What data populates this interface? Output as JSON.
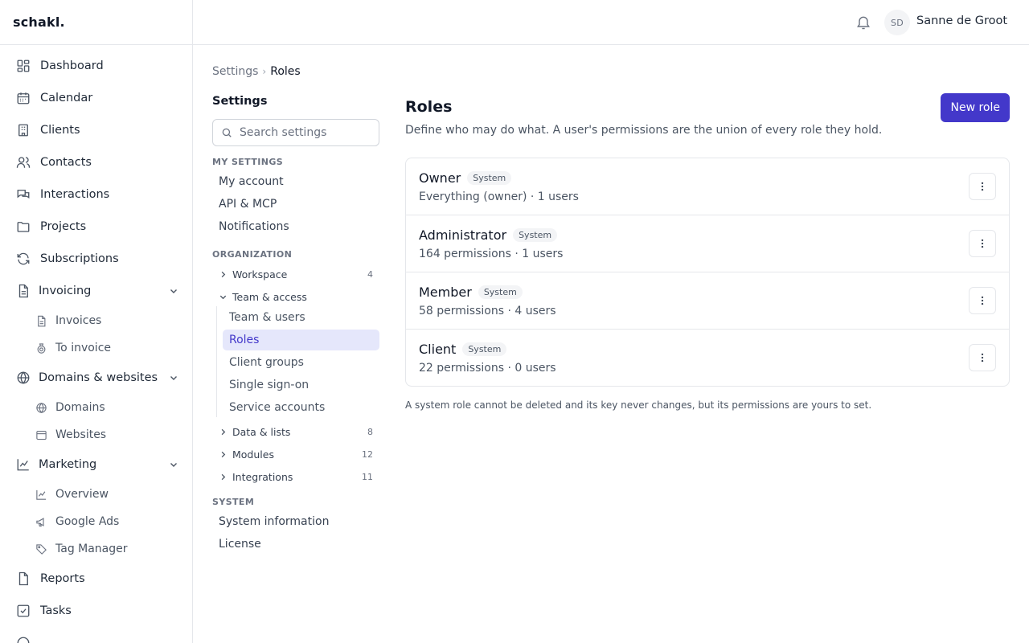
{
  "app": {
    "logo": "schakl."
  },
  "sidebar": {
    "items": [
      {
        "label": "Dashboard",
        "icon": "dashboard-icon"
      },
      {
        "label": "Calendar",
        "icon": "calendar-icon"
      },
      {
        "label": "Clients",
        "icon": "clients-icon"
      },
      {
        "label": "Contacts",
        "icon": "contacts-icon"
      },
      {
        "label": "Interactions",
        "icon": "interactions-icon"
      },
      {
        "label": "Projects",
        "icon": "folder-icon"
      },
      {
        "label": "Subscriptions",
        "icon": "refresh-icon"
      }
    ],
    "invoicing": {
      "label": "Invoicing",
      "children": [
        "Invoices",
        "To invoice"
      ]
    },
    "domains": {
      "label": "Domains & websites",
      "children": [
        "Domains",
        "Websites"
      ]
    },
    "marketing": {
      "label": "Marketing",
      "children": [
        "Overview",
        "Google Ads",
        "Tag Manager"
      ]
    },
    "bottom_items": [
      {
        "label": "Reports",
        "icon": "reports-icon"
      },
      {
        "label": "Tasks",
        "icon": "tasks-icon"
      }
    ]
  },
  "topbar": {
    "avatar_initials": "SD",
    "user_name": "Sanne de Groot"
  },
  "breadcrumb": {
    "parent": "Settings",
    "separator": "›",
    "current": "Roles"
  },
  "settings_nav": {
    "title": "Settings",
    "search_placeholder": "Search settings",
    "my_settings": {
      "label": "MY SETTINGS",
      "items": [
        "My account",
        "API & MCP",
        "Notifications"
      ]
    },
    "organization": {
      "label": "ORGANIZATION",
      "workspace": {
        "label": "Workspace",
        "count": "4"
      },
      "team_access": {
        "label": "Team & access",
        "children": [
          "Team & users",
          "Roles",
          "Client groups",
          "Single sign-on",
          "Service accounts"
        ]
      },
      "data_lists": {
        "label": "Data & lists",
        "count": "8"
      },
      "modules": {
        "label": "Modules",
        "count": "12"
      },
      "integrations": {
        "label": "Integrations",
        "count": "11"
      }
    },
    "system": {
      "label": "SYSTEM",
      "items": [
        "System information",
        "License"
      ]
    }
  },
  "main": {
    "title": "Roles",
    "description": "Define who may do what. A user's permissions are the union of every role they hold.",
    "new_role_button": "New role",
    "roles": [
      {
        "name": "Owner",
        "badge": "System",
        "meta": "Everything (owner) · 1 users"
      },
      {
        "name": "Administrator",
        "badge": "System",
        "meta": "164 permissions · 1 users"
      },
      {
        "name": "Member",
        "badge": "System",
        "meta": "58 permissions · 4 users"
      },
      {
        "name": "Client",
        "badge": "System",
        "meta": "22 permissions · 0 users"
      }
    ],
    "footnote": "A system role cannot be deleted and its key never changes, but its permissions are yours to set."
  },
  "colors": {
    "accent": "#4338ca",
    "active_bg": "#e5e7fb",
    "border": "#e5e7eb"
  }
}
